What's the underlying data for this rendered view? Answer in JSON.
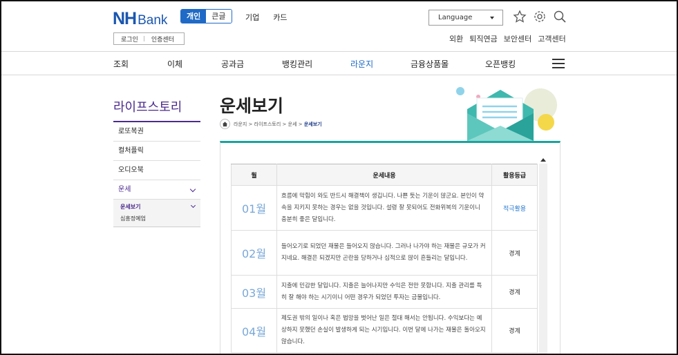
{
  "brand": {
    "nh": "NH",
    "bank": "Bank"
  },
  "segments": [
    "개인",
    "큰글"
  ],
  "top_nav": [
    "기업",
    "카드"
  ],
  "language": "Language",
  "login": {
    "login": "로그인",
    "cert": "인증센터"
  },
  "util_links": [
    "외환",
    "퇴직연금",
    "보안센터",
    "고객센터"
  ],
  "gnb": [
    "조회",
    "이체",
    "공과금",
    "뱅킹관리",
    "라운지",
    "금융상품몰",
    "오픈뱅킹"
  ],
  "gnb_active": "라운지",
  "lnb": {
    "title": "라이프스토리",
    "items": [
      "로또복권",
      "컬처플릭",
      "오디오북",
      "운세"
    ],
    "sub": [
      "운세보기",
      "심흥정예업"
    ]
  },
  "page_title": "운세보기",
  "breadcrumb": [
    "라운지",
    "라이프스토리",
    "운세",
    "운세보기"
  ],
  "table": {
    "headers": [
      "월",
      "운세내용",
      "활용등급"
    ],
    "rows": [
      {
        "month": "01월",
        "text": "흐름에 막힘이 와도 반드시 해결책이 생깁니다. 나쁜 듯는 기운이 많군요. 본인이 약속을 지키지 못하는 경우는 없을 것입니다. 설령 잘 못되어도 전화위복의 기운이니 충분히 좋은 달입니다.",
        "grade": "적극활용"
      },
      {
        "month": "02월",
        "text": "들어오기로 되었던 재물은 들어오지 않습니다. 그러나 나가야 하는 재물은 규모가 커지네요. 해결은 되겠지만 곤란을 당하거나 심적으로 많이 흔들리는 달입니다.",
        "grade": "경계"
      },
      {
        "month": "03월",
        "text": "지출에 민감한 달입니다. 지출은 늘어나지만 수익은 전만 못합니다. 지출 관리를 특히 잘 해야 하는 시기이니 어떤 경우가 되었던 투자는 금물입니다.",
        "grade": "경계"
      },
      {
        "month": "04월",
        "text": "제도권 밖의 일이나 혹은 법망을 벗어난 일은 절대 해서는 안됩니다. 수익보다는 예상하지 못했던 손실이 발생하게 되는 시기입니다. 이번 달에 나가는 재물은 돌아오지 않습니다.",
        "grade": "경계"
      }
    ]
  },
  "colors": {
    "brand": "#1a56b0",
    "accent": "#4b2a8e",
    "teal": "#1aa39c"
  }
}
